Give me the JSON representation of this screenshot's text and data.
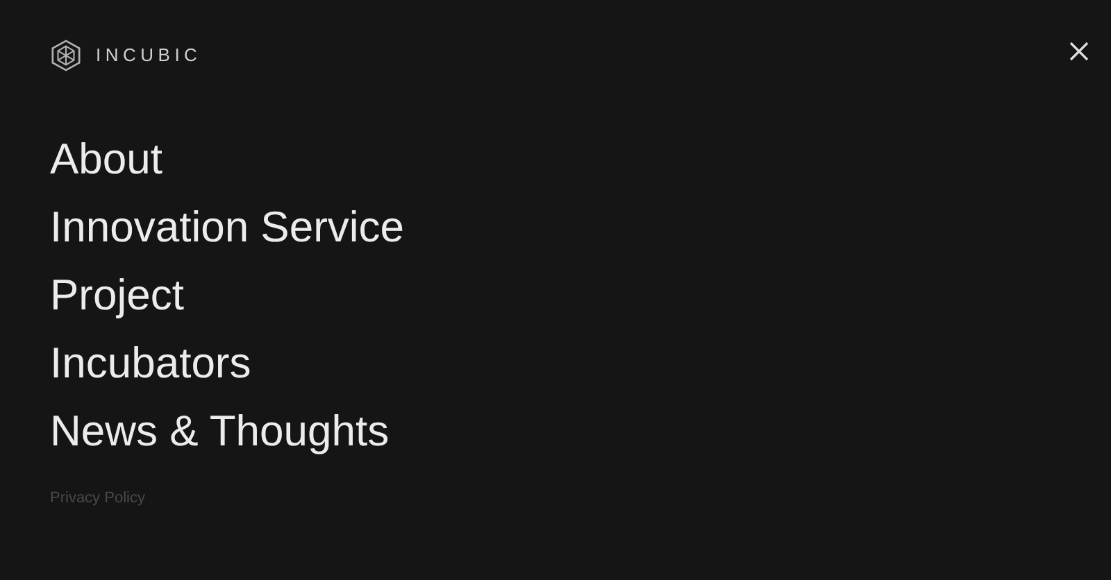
{
  "brand": {
    "name": "INCUBIC"
  },
  "menu": [
    {
      "label": "About"
    },
    {
      "label": "Innovation Service"
    },
    {
      "label": "Project"
    },
    {
      "label": "Incubators"
    },
    {
      "label": "News & Thoughts"
    }
  ],
  "footer_link": "Privacy Policy"
}
